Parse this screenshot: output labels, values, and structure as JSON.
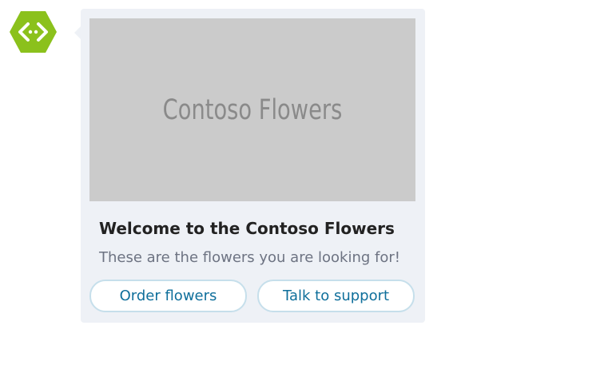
{
  "bot": {
    "avatar_icon": "bot-code-hexagon-icon",
    "avatar_color": "#8bc11c"
  },
  "card": {
    "hero_image_text": "Contoso Flowers",
    "title": "Welcome to the Contoso Flowers",
    "subtitle": "These are the flowers you are looking for!",
    "actions": [
      {
        "label": "Order flowers"
      },
      {
        "label": "Talk to support"
      }
    ],
    "colors": {
      "card_background": "#eef1f6",
      "hero_background": "#cbcbcb",
      "button_text": "#0f6f9b",
      "button_border": "#c6dfeb"
    }
  }
}
